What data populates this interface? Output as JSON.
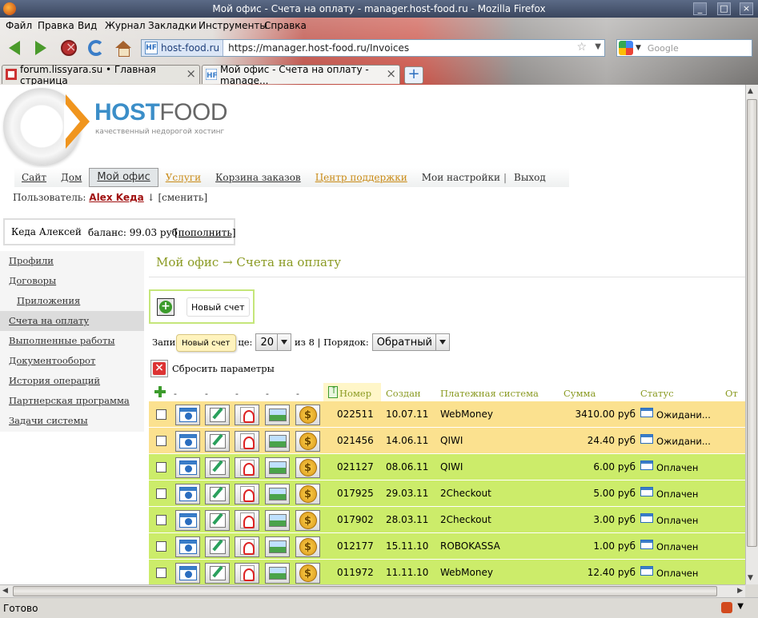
{
  "window": {
    "title": "Мой офис - Счета на оплату - manager.host-food.ru - Mozilla Firefox",
    "controls": [
      "_",
      "□",
      "×"
    ]
  },
  "menu": [
    "Файл",
    "Правка",
    "Вид",
    "Журнал",
    "Закладки",
    "Инструменты",
    "Справка"
  ],
  "urlbar": {
    "site": "host-food.ru",
    "favicon_text": "HF",
    "url": "https://manager.host-food.ru/Invoices",
    "star": "☆",
    "drop": "▼"
  },
  "search": {
    "placeholder": "Google",
    "drop": "▼"
  },
  "tabs": [
    {
      "label": "forum.lissyara.su • Главная страница",
      "close": "×"
    },
    {
      "label": "Мой офис - Счета на оплату - manage...",
      "close": "×"
    }
  ],
  "newtab": "+",
  "logo": {
    "host": "HOST",
    "food": "FOOD",
    "tagline": "качественный недорогой хостинг"
  },
  "sitenav": [
    "Сайт",
    "Дом",
    "Мой офис",
    "Услуги",
    "Корзина заказов",
    "Центр поддержки",
    "Мои настройки",
    "|",
    "Выход"
  ],
  "user": {
    "prefix": "Пользователь: ",
    "name": "Alex Keда",
    "suffix": " ↓ [сменить]"
  },
  "balance": {
    "name": "Кеда Алексей",
    "balance": "баланс: 99.03 руб",
    "topup": "[пополнить]"
  },
  "sidebar": [
    "Профили",
    "Договоры",
    "Приложения",
    "Счета на оплату",
    "Выполненные работы",
    "Документооборот",
    "История операций",
    "Партнерская программа",
    "Задачи системы"
  ],
  "content": {
    "title": "Мой офис → Счета на оплату",
    "new_invoice": "Новый счет",
    "filter_prefix": "Запи",
    "filter_mid": "це:",
    "per_page": "20",
    "of_pages": "из 8 | Порядок:",
    "order": "Обратный",
    "tooltip": "Новый счет",
    "reset": "Сбросить параметры"
  },
  "table": {
    "headers": {
      "d1": "-",
      "d2": "-",
      "d3": "-",
      "d4": "-",
      "d5": "-",
      "number": "Номер",
      "created": "Создан",
      "system": "Платежная система",
      "sum": "Сумма",
      "status": "Статус",
      "from": "От с"
    },
    "rows": [
      {
        "number": "022511",
        "date": "10.07.11",
        "system": "WebMoney",
        "sum": "3410.00 руб",
        "status": "Ожидани...",
        "state": "wait"
      },
      {
        "number": "021456",
        "date": "14.06.11",
        "system": "QIWI",
        "sum": "24.40 руб",
        "status": "Ожидани...",
        "state": "wait"
      },
      {
        "number": "021127",
        "date": "08.06.11",
        "system": "QIWI",
        "sum": "6.00 руб",
        "status": "Оплачен",
        "state": "paid"
      },
      {
        "number": "017925",
        "date": "29.03.11",
        "system": "2Checkout",
        "sum": "5.00 руб",
        "status": "Оплачен",
        "state": "paid"
      },
      {
        "number": "017902",
        "date": "28.03.11",
        "system": "2Checkout",
        "sum": "3.00 руб",
        "status": "Оплачен",
        "state": "paid"
      },
      {
        "number": "012177",
        "date": "15.11.10",
        "system": "ROBOKASSA",
        "sum": "1.00 руб",
        "status": "Оплачен",
        "state": "paid"
      },
      {
        "number": "011972",
        "date": "11.11.10",
        "system": "WebMoney",
        "sum": "12.40 руб",
        "status": "Оплачен",
        "state": "paid"
      }
    ],
    "pay_symbol": "$"
  },
  "statusbar": {
    "text": "Готово",
    "drop": "▼"
  },
  "scroll": {
    "up": "▲",
    "down": "▼",
    "left": "◀",
    "right": "▶"
  }
}
